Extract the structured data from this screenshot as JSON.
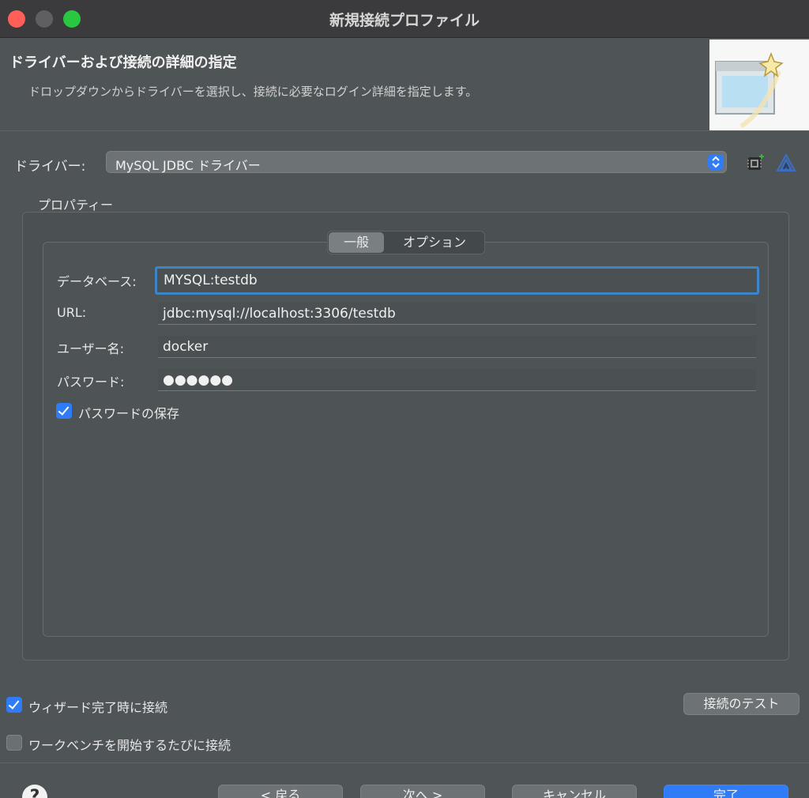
{
  "window": {
    "title": "新規接続プロファイル"
  },
  "header": {
    "title": "ドライバーおよび接続の詳細の指定",
    "description": "ドロップダウンからドライバーを選択し、接続に必要なログイン詳細を指定します。"
  },
  "driver": {
    "label": "ドライバー:",
    "selected": "MySQL JDBC ドライバー"
  },
  "properties": {
    "label": "プロパティー",
    "tabs": [
      "一般",
      "オプション"
    ],
    "fields": {
      "database": {
        "label": "データベース:",
        "value": "MYSQL:testdb"
      },
      "url": {
        "label": "URL:",
        "value": "jdbc:mysql://localhost:3306/testdb"
      },
      "username": {
        "label": "ユーザー名:",
        "value": "docker"
      },
      "password": {
        "label": "パスワード:",
        "value": "●●●●●●"
      }
    },
    "save_password": {
      "label": "パスワードの保存",
      "checked": true
    }
  },
  "options": {
    "connect_on_finish": {
      "label": "ウィザード完了時に接続",
      "checked": true
    },
    "connect_on_startup": {
      "label": "ワークベンチを開始するたびに接続",
      "checked": false
    }
  },
  "buttons": {
    "test_connection": "接続のテスト",
    "back": "< 戻る",
    "next": "次へ >",
    "cancel": "キャンセル",
    "finish": "完了"
  },
  "colors": {
    "accent": "#2f7cf6",
    "focus_ring": "#3d85c6",
    "background": "#4f5457"
  }
}
